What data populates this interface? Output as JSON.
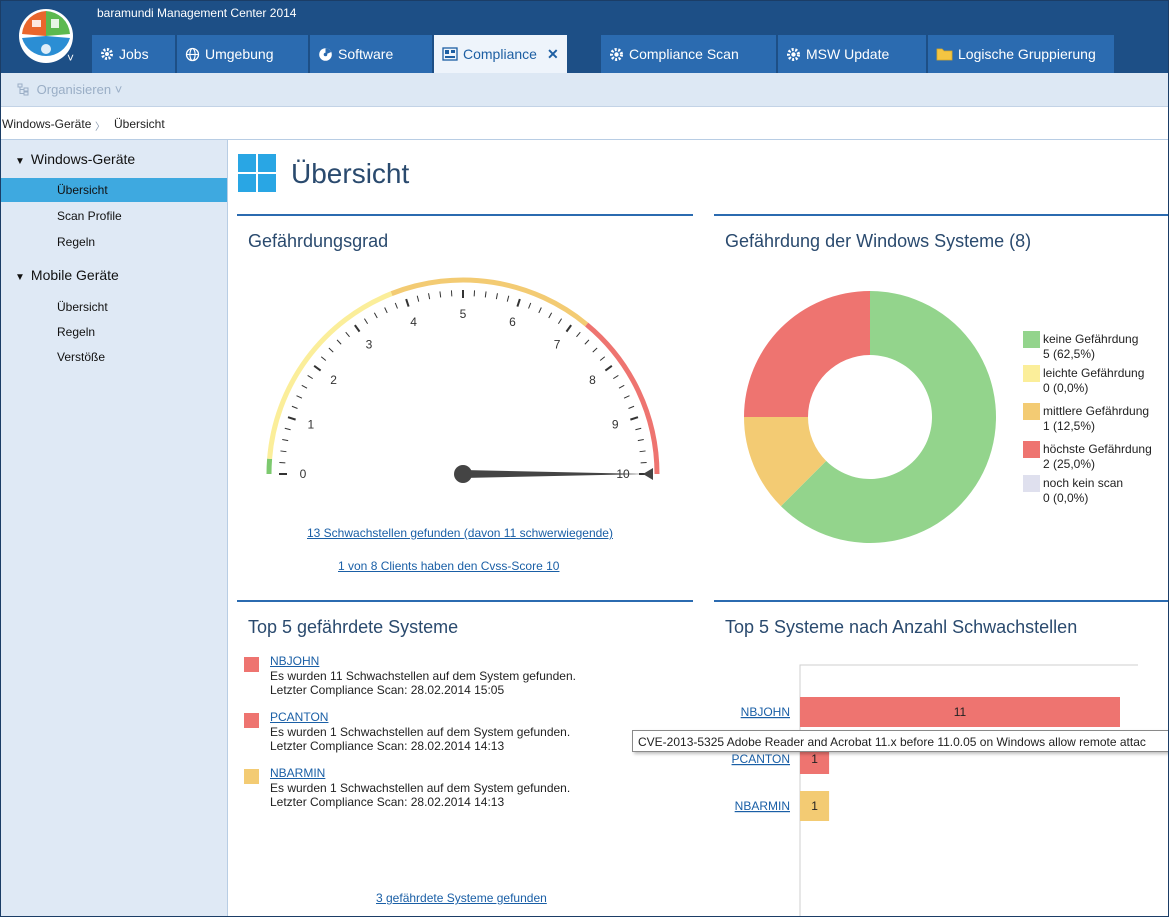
{
  "app": {
    "title": "baramundi Management Center 2014"
  },
  "tabs": [
    {
      "label": "Jobs"
    },
    {
      "label": "Umgebung"
    },
    {
      "label": "Software"
    },
    {
      "label": "Compliance",
      "close": "✕"
    },
    {
      "label": "Compliance Scan"
    },
    {
      "label": "MSW Update"
    },
    {
      "label": "Logische Gruppierung"
    }
  ],
  "toolbar": {
    "organize_label": "Organisieren",
    "organize_chevron": "˅"
  },
  "breadcrumb": {
    "root": "Windows-Geräte",
    "sep": "〉",
    "current": "Übersicht"
  },
  "sidebar": {
    "groups": [
      {
        "label": "Windows-Geräte",
        "items": [
          "Übersicht",
          "Scan Profile",
          "Regeln"
        ]
      },
      {
        "label": "Mobile Geräte",
        "items": [
          "Übersicht",
          "Regeln",
          "Verstöße"
        ]
      }
    ]
  },
  "page": {
    "title": "Übersicht"
  },
  "gauge": {
    "title": "Gefährdungsgrad",
    "ticks": [
      "0",
      "1",
      "2",
      "3",
      "4",
      "5",
      "6",
      "7",
      "8",
      "9",
      "10"
    ],
    "value": 10,
    "link1": "13 Schwachstellen gefunden (davon 11 schwerwiegende)",
    "link2": "1 von 8 Clients haben den Cvss-Score 10"
  },
  "donut": {
    "title": "Gefährdung der Windows Systeme (8)",
    "legend": [
      {
        "label": "keine Gefährdung",
        "value": "5 (62,5%)",
        "color": "#93d48c"
      },
      {
        "label": "leichte Gefährdung",
        "value": "0 (0,0%)",
        "color": "#fbee9a"
      },
      {
        "label": "mittlere Gefährdung",
        "value": "1 (12,5%)",
        "color": "#f3cb73"
      },
      {
        "label": "höchste Gefährdung",
        "value": "2 (25,0%)",
        "color": "#ee7470"
      },
      {
        "label": "noch kein scan",
        "value": "0 (0,0%)",
        "color": "#dfe0ee"
      }
    ]
  },
  "top5": {
    "title": "Top 5 gefährdete Systeme",
    "systems": [
      {
        "name": "NBJOHN",
        "line1": "Es wurden 11 Schwachstellen auf dem System gefunden.",
        "line2": "Letzter Compliance Scan: 28.02.2014 15:05",
        "color": "#ee7470"
      },
      {
        "name": "PCANTON",
        "line1": "Es wurden 1 Schwachstellen auf dem System gefunden.",
        "line2": "Letzter Compliance Scan: 28.02.2014 14:13",
        "color": "#ee7470"
      },
      {
        "name": "NBARMIN",
        "line1": "Es wurden 1 Schwachstellen auf dem System gefunden.",
        "line2": "Letzter Compliance Scan: 28.02.2014 14:13",
        "color": "#f3cb73"
      }
    ],
    "footer_link": "3 gefährdete Systeme gefunden"
  },
  "chart_data": [
    {
      "type": "pie",
      "title": "Gefährdung der Windows Systeme (8)",
      "categories": [
        "keine Gefährdung",
        "leichte Gefährdung",
        "mittlere Gefährdung",
        "höchste Gefährdung",
        "noch kein scan"
      ],
      "values": [
        5,
        0,
        1,
        2,
        0
      ],
      "colors": [
        "#93d48c",
        "#fbee9a",
        "#f3cb73",
        "#ee7470",
        "#dfe0ee"
      ]
    },
    {
      "type": "bar",
      "title": "Top 5 Systeme nach Anzahl Schwachstellen",
      "categories": [
        "NBJOHN",
        "PCANTON",
        "NBARMIN"
      ],
      "values": [
        11,
        1,
        1
      ],
      "colors": [
        "#ee7470",
        "#ee7470",
        "#f3cb73"
      ],
      "xlim": [
        0,
        11
      ]
    }
  ],
  "tooltip": {
    "text": "CVE-2013-5325 Adobe Reader and Acrobat 11.x before 11.0.05 on Windows allow remote attac"
  }
}
